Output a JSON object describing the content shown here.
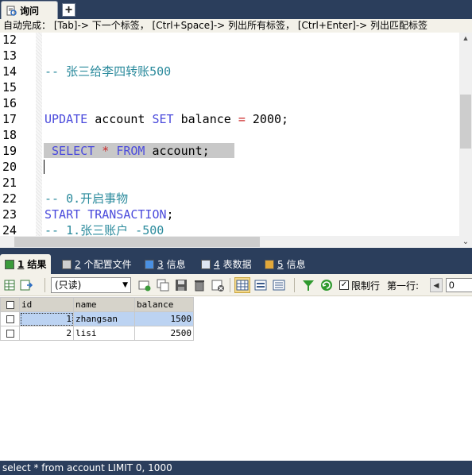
{
  "query_tab": {
    "label": "询问",
    "add_label": "+"
  },
  "autocomplete_hint": "自动完成： [Tab]-> 下一个标签， [Ctrl+Space]-> 列出所有标签， [Ctrl+Enter]-> 列出匹配标签",
  "editor": {
    "lines": [
      {
        "num": "12",
        "tokens": []
      },
      {
        "num": "13",
        "tokens": []
      },
      {
        "num": "14",
        "tokens": [
          {
            "t": "cm",
            "v": "-- 张三给李四转账500"
          }
        ]
      },
      {
        "num": "15",
        "tokens": []
      },
      {
        "num": "16",
        "tokens": []
      },
      {
        "num": "17",
        "tokens": [
          {
            "t": "kw",
            "v": "UPDATE"
          },
          {
            "t": "tx",
            "v": " account "
          },
          {
            "t": "kw",
            "v": "SET"
          },
          {
            "t": "tx",
            "v": " balance "
          },
          {
            "t": "op",
            "v": "="
          },
          {
            "t": "tx",
            "v": " 2000;"
          }
        ]
      },
      {
        "num": "18",
        "tokens": []
      },
      {
        "num": "19",
        "tokens": [
          {
            "t": "tx",
            "v": " "
          },
          {
            "t": "kw",
            "v": "SELECT"
          },
          {
            "t": "tx",
            "v": " "
          },
          {
            "t": "op",
            "v": "*"
          },
          {
            "t": "tx",
            "v": " "
          },
          {
            "t": "kw",
            "v": "FROM"
          },
          {
            "t": "tx",
            "v": " account;"
          }
        ]
      },
      {
        "num": "20",
        "tokens": []
      },
      {
        "num": "21",
        "tokens": []
      },
      {
        "num": "22",
        "tokens": [
          {
            "t": "cm",
            "v": "-- 0.开启事物"
          }
        ]
      },
      {
        "num": "23",
        "tokens": [
          {
            "t": "kw",
            "v": "START"
          },
          {
            "t": "tx",
            "v": " "
          },
          {
            "t": "kw",
            "v": "TRANSACTION"
          },
          {
            "t": "tx",
            "v": ";"
          }
        ]
      },
      {
        "num": "24",
        "tokens": [
          {
            "t": "cm",
            "v": "-- 1.张三账户 -500"
          }
        ]
      }
    ]
  },
  "result_tabs": [
    {
      "num": "1",
      "label": "结果",
      "icon": "grid-icon",
      "active": true
    },
    {
      "num": "2",
      "label": "个配置文件",
      "icon": "profile-icon",
      "active": false
    },
    {
      "num": "3",
      "label": "信息",
      "icon": "info-icon",
      "active": false
    },
    {
      "num": "4",
      "label": "表数据",
      "icon": "table-data-icon",
      "active": false
    },
    {
      "num": "5",
      "label": "信息",
      "icon": "info-blocks-icon",
      "active": false
    }
  ],
  "toolbar": {
    "readonly_select": "(只读)",
    "limit_rows_label": "限制行",
    "limit_rows_checked": true,
    "first_row_label": "第一行:",
    "first_row_value": "0"
  },
  "grid": {
    "columns": [
      "id",
      "name",
      "balance"
    ],
    "rows": [
      {
        "id": "1",
        "name": "zhangsan",
        "balance": "1500"
      },
      {
        "id": "2",
        "name": "lisi",
        "balance": "2500"
      }
    ]
  },
  "status": "select * from account LIMIT 0, 1000",
  "colors": {
    "chrome": "#2b3e5c",
    "keyword": "#4b4bdc",
    "comment": "#2a8a9c",
    "operator": "#cc2a2a",
    "panel": "#f3f1e9"
  }
}
